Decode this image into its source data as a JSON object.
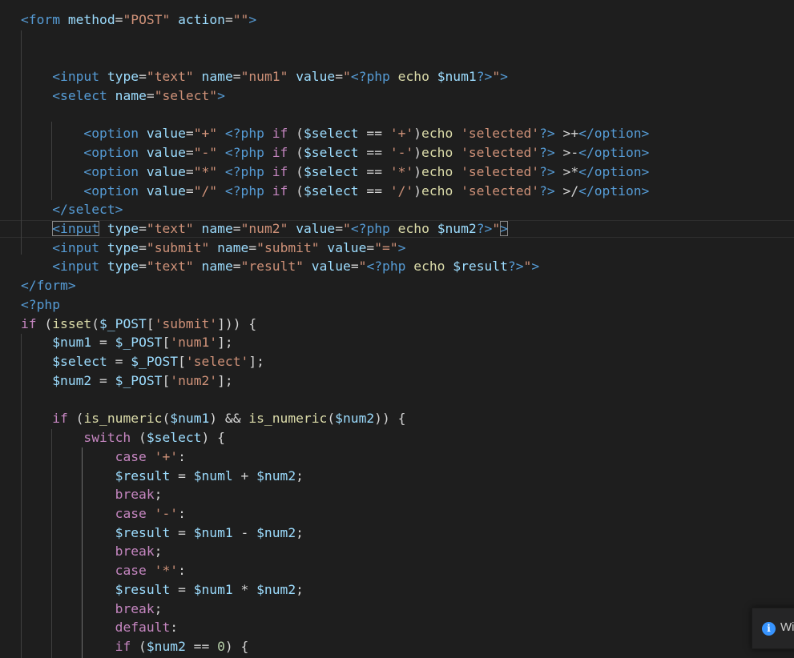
{
  "editor": {
    "lines": [
      [
        [
          "t",
          "<form"
        ],
        [
          "x",
          " "
        ],
        [
          "a",
          "method"
        ],
        [
          "x",
          "="
        ],
        [
          "s",
          "\"POST\""
        ],
        [
          "x",
          " "
        ],
        [
          "a",
          "action"
        ],
        [
          "x",
          "="
        ],
        [
          "s",
          "\"\""
        ],
        [
          "t",
          ">"
        ]
      ],
      [],
      [],
      [
        [
          "x",
          "    "
        ],
        [
          "t",
          "<input"
        ],
        [
          "x",
          " "
        ],
        [
          "a",
          "type"
        ],
        [
          "x",
          "="
        ],
        [
          "s",
          "\"text\""
        ],
        [
          "x",
          " "
        ],
        [
          "a",
          "name"
        ],
        [
          "x",
          "="
        ],
        [
          "s",
          "\"num1\""
        ],
        [
          "x",
          " "
        ],
        [
          "a",
          "value"
        ],
        [
          "x",
          "="
        ],
        [
          "s",
          "\""
        ],
        [
          "t",
          "<?php"
        ],
        [
          "x",
          " "
        ],
        [
          "f",
          "echo"
        ],
        [
          "x",
          " "
        ],
        [
          "a",
          "$num1"
        ],
        [
          "t",
          "?>"
        ],
        [
          "s",
          "\""
        ],
        [
          "t",
          ">"
        ]
      ],
      [
        [
          "x",
          "    "
        ],
        [
          "t",
          "<select"
        ],
        [
          "x",
          " "
        ],
        [
          "a",
          "name"
        ],
        [
          "x",
          "="
        ],
        [
          "s",
          "\"select\""
        ],
        [
          "t",
          ">"
        ]
      ],
      [],
      [
        [
          "x",
          "        "
        ],
        [
          "t",
          "<option"
        ],
        [
          "x",
          " "
        ],
        [
          "a",
          "value"
        ],
        [
          "x",
          "="
        ],
        [
          "s",
          "\"+\""
        ],
        [
          "x",
          " "
        ],
        [
          "t",
          "<?php"
        ],
        [
          "x",
          " "
        ],
        [
          "k",
          "if"
        ],
        [
          "x",
          " ("
        ],
        [
          "a",
          "$select"
        ],
        [
          "x",
          " == "
        ],
        [
          "s",
          "'+'"
        ],
        [
          "x",
          ")"
        ],
        [
          "f",
          "echo"
        ],
        [
          "x",
          " "
        ],
        [
          "s",
          "'selected'"
        ],
        [
          "t",
          "?>"
        ],
        [
          "x",
          " >+"
        ],
        [
          "t",
          "</option>"
        ]
      ],
      [
        [
          "x",
          "        "
        ],
        [
          "t",
          "<option"
        ],
        [
          "x",
          " "
        ],
        [
          "a",
          "value"
        ],
        [
          "x",
          "="
        ],
        [
          "s",
          "\"-\""
        ],
        [
          "x",
          " "
        ],
        [
          "t",
          "<?php"
        ],
        [
          "x",
          " "
        ],
        [
          "k",
          "if"
        ],
        [
          "x",
          " ("
        ],
        [
          "a",
          "$select"
        ],
        [
          "x",
          " == "
        ],
        [
          "s",
          "'-'"
        ],
        [
          "x",
          ")"
        ],
        [
          "f",
          "echo"
        ],
        [
          "x",
          " "
        ],
        [
          "s",
          "'selected'"
        ],
        [
          "t",
          "?>"
        ],
        [
          "x",
          " >-"
        ],
        [
          "t",
          "</option>"
        ]
      ],
      [
        [
          "x",
          "        "
        ],
        [
          "t",
          "<option"
        ],
        [
          "x",
          " "
        ],
        [
          "a",
          "value"
        ],
        [
          "x",
          "="
        ],
        [
          "s",
          "\"*\""
        ],
        [
          "x",
          " "
        ],
        [
          "t",
          "<?php"
        ],
        [
          "x",
          " "
        ],
        [
          "k",
          "if"
        ],
        [
          "x",
          " ("
        ],
        [
          "a",
          "$select"
        ],
        [
          "x",
          " == "
        ],
        [
          "s",
          "'*'"
        ],
        [
          "x",
          ")"
        ],
        [
          "f",
          "echo"
        ],
        [
          "x",
          " "
        ],
        [
          "s",
          "'selected'"
        ],
        [
          "t",
          "?>"
        ],
        [
          "x",
          " >*"
        ],
        [
          "t",
          "</option>"
        ]
      ],
      [
        [
          "x",
          "        "
        ],
        [
          "t",
          "<option"
        ],
        [
          "x",
          " "
        ],
        [
          "a",
          "value"
        ],
        [
          "x",
          "="
        ],
        [
          "s",
          "\"/\""
        ],
        [
          "x",
          " "
        ],
        [
          "t",
          "<?php"
        ],
        [
          "x",
          " "
        ],
        [
          "k",
          "if"
        ],
        [
          "x",
          " ("
        ],
        [
          "a",
          "$select"
        ],
        [
          "x",
          " == "
        ],
        [
          "s",
          "'/'"
        ],
        [
          "x",
          ")"
        ],
        [
          "f",
          "echo"
        ],
        [
          "x",
          " "
        ],
        [
          "s",
          "'selected'"
        ],
        [
          "t",
          "?>"
        ],
        [
          "x",
          " >/"
        ],
        [
          "t",
          "</option>"
        ]
      ],
      [
        [
          "x",
          "    "
        ],
        [
          "t",
          "</select>"
        ]
      ],
      [
        [
          "x",
          "    "
        ],
        [
          "t",
          "<input",
          "bm"
        ],
        [
          "x",
          " "
        ],
        [
          "a",
          "type"
        ],
        [
          "x",
          "="
        ],
        [
          "s",
          "\"text\""
        ],
        [
          "x",
          " "
        ],
        [
          "a",
          "name"
        ],
        [
          "x",
          "="
        ],
        [
          "s",
          "\"num2\""
        ],
        [
          "x",
          " "
        ],
        [
          "a",
          "value"
        ],
        [
          "x",
          "="
        ],
        [
          "s",
          "\""
        ],
        [
          "t",
          "<?php"
        ],
        [
          "x",
          " "
        ],
        [
          "f",
          "echo"
        ],
        [
          "x",
          " "
        ],
        [
          "a",
          "$num2"
        ],
        [
          "t",
          "?>"
        ],
        [
          "s",
          "\""
        ],
        [
          "t",
          ">",
          "bm"
        ]
      ],
      [
        [
          "x",
          "    "
        ],
        [
          "t",
          "<input"
        ],
        [
          "x",
          " "
        ],
        [
          "a",
          "type"
        ],
        [
          "x",
          "="
        ],
        [
          "s",
          "\"submit\""
        ],
        [
          "x",
          " "
        ],
        [
          "a",
          "name"
        ],
        [
          "x",
          "="
        ],
        [
          "s",
          "\"submit\""
        ],
        [
          "x",
          " "
        ],
        [
          "a",
          "value"
        ],
        [
          "x",
          "="
        ],
        [
          "s",
          "\"=\""
        ],
        [
          "t",
          ">"
        ]
      ],
      [
        [
          "x",
          "    "
        ],
        [
          "t",
          "<input"
        ],
        [
          "x",
          " "
        ],
        [
          "a",
          "type"
        ],
        [
          "x",
          "="
        ],
        [
          "s",
          "\"text\""
        ],
        [
          "x",
          " "
        ],
        [
          "a",
          "name"
        ],
        [
          "x",
          "="
        ],
        [
          "s",
          "\"result\""
        ],
        [
          "x",
          " "
        ],
        [
          "a",
          "value"
        ],
        [
          "x",
          "="
        ],
        [
          "s",
          "\""
        ],
        [
          "t",
          "<?php"
        ],
        [
          "x",
          " "
        ],
        [
          "f",
          "echo"
        ],
        [
          "x",
          " "
        ],
        [
          "a",
          "$result"
        ],
        [
          "t",
          "?>"
        ],
        [
          "s",
          "\""
        ],
        [
          "t",
          ">"
        ]
      ],
      [
        [
          "t",
          "</form>"
        ]
      ],
      [
        [
          "t",
          "<?php"
        ]
      ],
      [
        [
          "k",
          "if"
        ],
        [
          "x",
          " ("
        ],
        [
          "f",
          "isset"
        ],
        [
          "x",
          "("
        ],
        [
          "a",
          "$_POST"
        ],
        [
          "x",
          "["
        ],
        [
          "s",
          "'submit'"
        ],
        [
          "x",
          "])) {"
        ]
      ],
      [
        [
          "x",
          "    "
        ],
        [
          "a",
          "$num1"
        ],
        [
          "x",
          " = "
        ],
        [
          "a",
          "$_POST"
        ],
        [
          "x",
          "["
        ],
        [
          "s",
          "'num1'"
        ],
        [
          "x",
          "];"
        ]
      ],
      [
        [
          "x",
          "    "
        ],
        [
          "a",
          "$select"
        ],
        [
          "x",
          " = "
        ],
        [
          "a",
          "$_POST"
        ],
        [
          "x",
          "["
        ],
        [
          "s",
          "'select'"
        ],
        [
          "x",
          "];"
        ]
      ],
      [
        [
          "x",
          "    "
        ],
        [
          "a",
          "$num2"
        ],
        [
          "x",
          " = "
        ],
        [
          "a",
          "$_POST"
        ],
        [
          "x",
          "["
        ],
        [
          "s",
          "'num2'"
        ],
        [
          "x",
          "];"
        ]
      ],
      [],
      [
        [
          "x",
          "    "
        ],
        [
          "k",
          "if"
        ],
        [
          "x",
          " ("
        ],
        [
          "f",
          "is_numeric"
        ],
        [
          "x",
          "("
        ],
        [
          "a",
          "$num1"
        ],
        [
          "x",
          ") && "
        ],
        [
          "f",
          "is_numeric"
        ],
        [
          "x",
          "("
        ],
        [
          "a",
          "$num2"
        ],
        [
          "x",
          ")) {"
        ]
      ],
      [
        [
          "x",
          "        "
        ],
        [
          "k",
          "switch"
        ],
        [
          "x",
          " ("
        ],
        [
          "a",
          "$select"
        ],
        [
          "x",
          ") {"
        ]
      ],
      [
        [
          "x",
          "            "
        ],
        [
          "k",
          "case"
        ],
        [
          "x",
          " "
        ],
        [
          "s",
          "'+'"
        ],
        [
          "x",
          ":"
        ]
      ],
      [
        [
          "x",
          "            "
        ],
        [
          "a",
          "$result"
        ],
        [
          "x",
          " = "
        ],
        [
          "a",
          "$numl"
        ],
        [
          "x",
          " + "
        ],
        [
          "a",
          "$num2"
        ],
        [
          "x",
          ";"
        ]
      ],
      [
        [
          "x",
          "            "
        ],
        [
          "k",
          "break"
        ],
        [
          "x",
          ";"
        ]
      ],
      [
        [
          "x",
          "            "
        ],
        [
          "k",
          "case"
        ],
        [
          "x",
          " "
        ],
        [
          "s",
          "'-'"
        ],
        [
          "x",
          ":"
        ]
      ],
      [
        [
          "x",
          "            "
        ],
        [
          "a",
          "$result"
        ],
        [
          "x",
          " = "
        ],
        [
          "a",
          "$num1"
        ],
        [
          "x",
          " - "
        ],
        [
          "a",
          "$num2"
        ],
        [
          "x",
          ";"
        ]
      ],
      [
        [
          "x",
          "            "
        ],
        [
          "k",
          "break"
        ],
        [
          "x",
          ";"
        ]
      ],
      [
        [
          "x",
          "            "
        ],
        [
          "k",
          "case"
        ],
        [
          "x",
          " "
        ],
        [
          "s",
          "'*'"
        ],
        [
          "x",
          ":"
        ]
      ],
      [
        [
          "x",
          "            "
        ],
        [
          "a",
          "$result"
        ],
        [
          "x",
          " = "
        ],
        [
          "a",
          "$num1"
        ],
        [
          "x",
          " * "
        ],
        [
          "a",
          "$num2"
        ],
        [
          "x",
          ";"
        ]
      ],
      [
        [
          "x",
          "            "
        ],
        [
          "k",
          "break"
        ],
        [
          "x",
          ";"
        ]
      ],
      [
        [
          "x",
          "            "
        ],
        [
          "k",
          "default"
        ],
        [
          "x",
          ":"
        ]
      ],
      [
        [
          "x",
          "            "
        ],
        [
          "k",
          "if"
        ],
        [
          "x",
          " ("
        ],
        [
          "a",
          "$num2"
        ],
        [
          "x",
          " == "
        ],
        [
          "n",
          "0"
        ],
        [
          "x",
          ") {"
        ]
      ]
    ]
  },
  "notification": {
    "icon": "info-icon",
    "icon_glyph": "i",
    "text": "Wi"
  },
  "colors": {
    "background": "#1e1e1e",
    "tag": "#569cd6",
    "attribute": "#9cdcfe",
    "string": "#ce9178",
    "keyword": "#c586c0",
    "function": "#dcdcaa",
    "number": "#b5cea8",
    "text": "#d4d4d4",
    "info": "#3794ff"
  }
}
